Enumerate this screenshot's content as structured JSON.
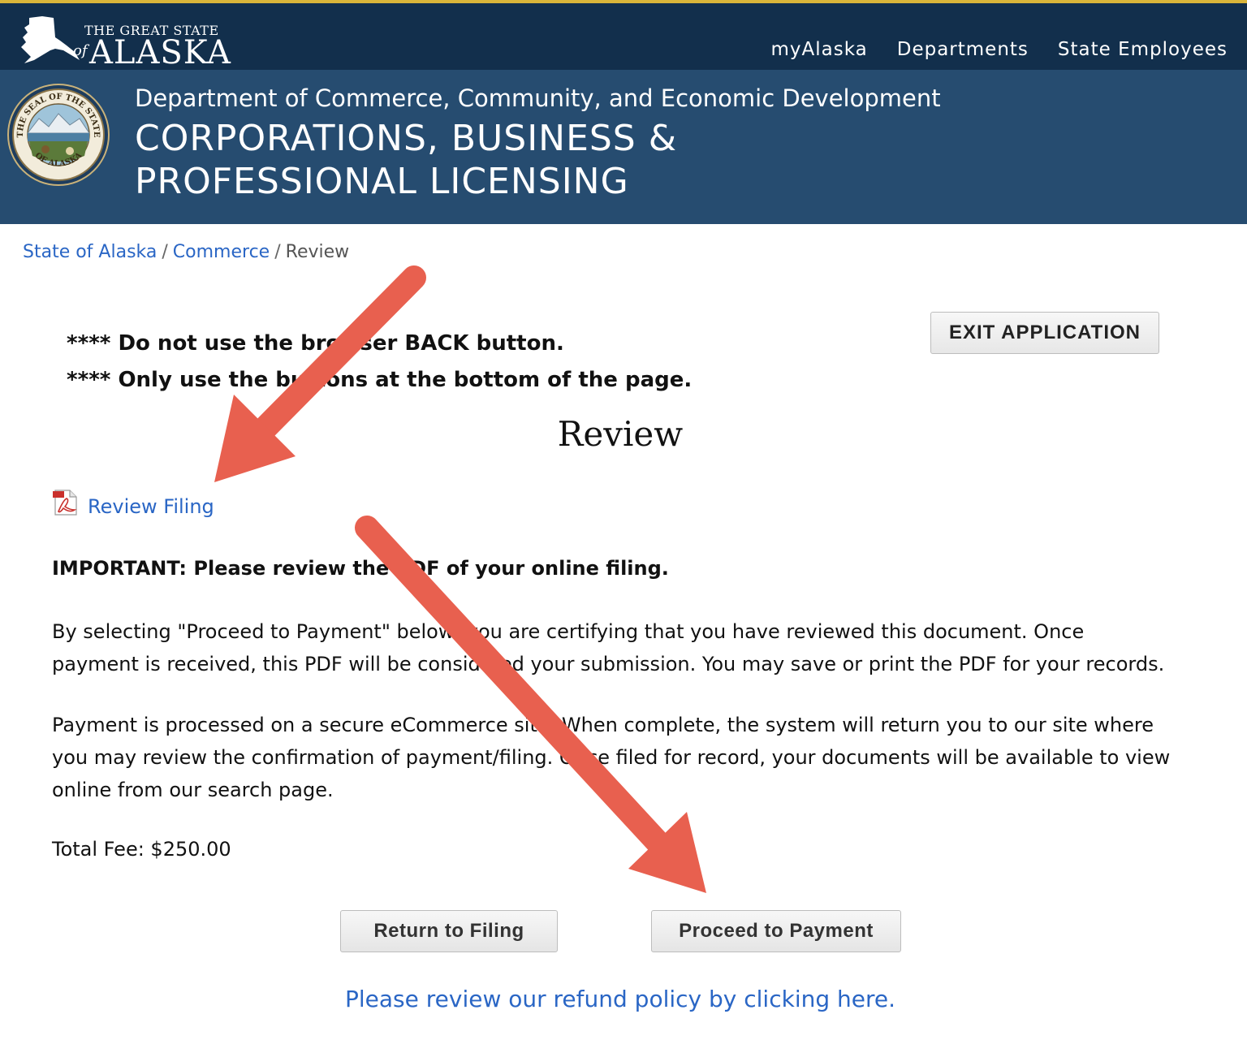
{
  "topbar": {
    "logo_small": "THE GREAT STATE",
    "logo_of": "of",
    "logo_big": "ALASKA",
    "nav": [
      "myAlaska",
      "Departments",
      "State Employees"
    ]
  },
  "header": {
    "seal_text_top": "THE SEAL OF THE STATE",
    "seal_text_bottom": "OF ALASKA",
    "department": "Department of Commerce, Community, and Economic Development",
    "division": "CORPORATIONS, BUSINESS & PROFESSIONAL LICENSING"
  },
  "breadcrumb": {
    "items": [
      "State of Alaska",
      "Commerce",
      "Review"
    ],
    "separator": "/"
  },
  "exit_button": "EXIT APPLICATION",
  "warnings": [
    "**** Do not use the browser BACK button.",
    "**** Only use the buttons at the bottom of the page."
  ],
  "review": {
    "title": "Review",
    "pdf_link": "Review Filing",
    "important": "IMPORTANT: Please review the PDF of your online filing.",
    "para1": "By selecting \"Proceed to Payment\" below, you are certifying that you have reviewed this document. Once payment is received, this PDF will be considered your submission. You may save or print the PDF for your records.",
    "para2": "Payment is processed on a secure eCommerce site. When complete, the system will return you to our site where you may review the confirmation of payment/filing. Once filed for record, your documents will be available to view online from our search page.",
    "total_fee": "Total Fee: $250.00"
  },
  "buttons": {
    "return": "Return to Filing",
    "proceed": "Proceed to Payment"
  },
  "refund_link": "Please review our refund policy by clicking here.",
  "colors": {
    "topbar": "#122f4c",
    "band": "#264c70",
    "link": "#2a66c5",
    "arrow": "#e8604f",
    "gold": "#d9b53a"
  }
}
